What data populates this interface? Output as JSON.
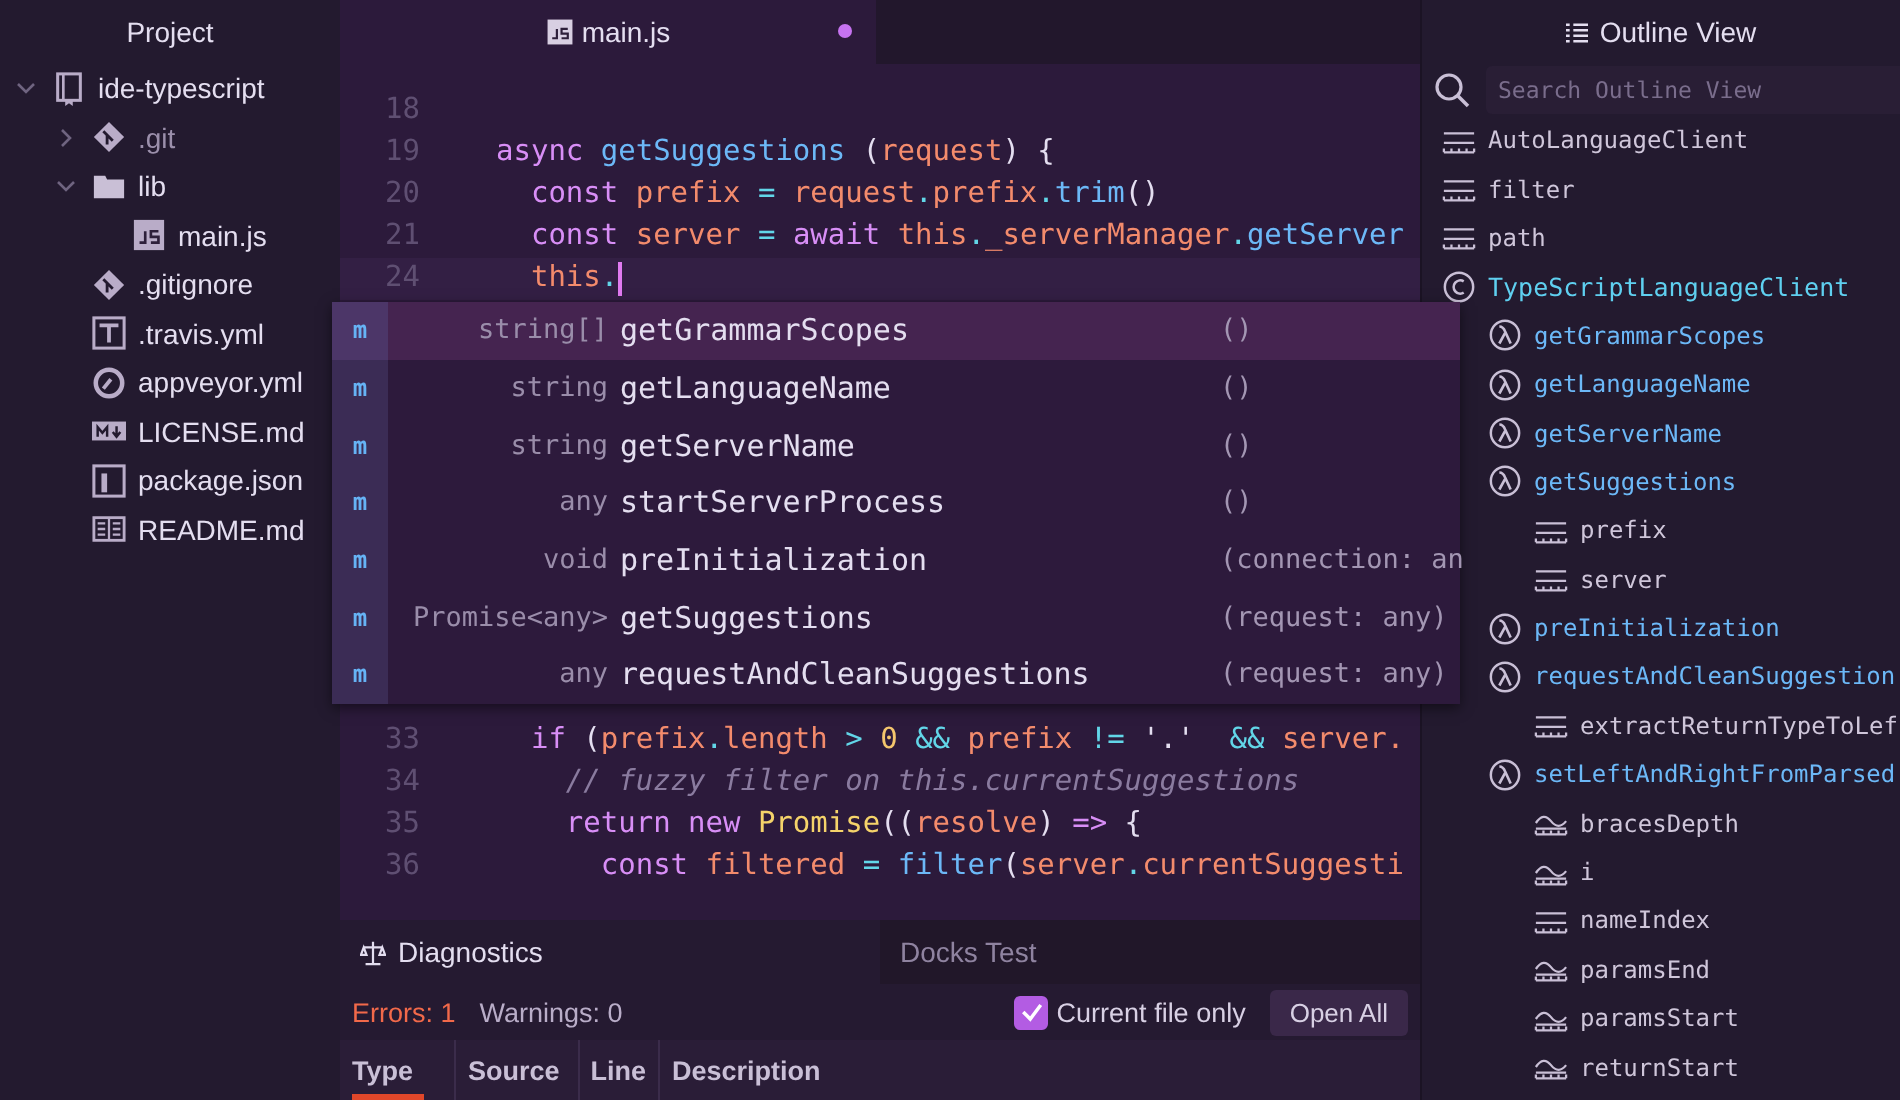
{
  "project": {
    "title": "Project",
    "tree": [
      {
        "name": "ide-typescript",
        "kind": "repo",
        "expanded": true,
        "children": [
          {
            "name": ".git",
            "kind": "git",
            "expanded": false
          },
          {
            "name": "lib",
            "kind": "folder",
            "expanded": true,
            "children": [
              {
                "name": "main.js",
                "kind": "js"
              }
            ]
          },
          {
            "name": ".gitignore",
            "kind": "git"
          },
          {
            "name": ".travis.yml",
            "kind": "travis"
          },
          {
            "name": "appveyor.yml",
            "kind": "appveyor"
          },
          {
            "name": "LICENSE.md",
            "kind": "markdown"
          },
          {
            "name": "package.json",
            "kind": "package"
          },
          {
            "name": "README.md",
            "kind": "readme"
          }
        ]
      }
    ]
  },
  "editor": {
    "tabs": [
      {
        "label": "main.js",
        "modified": true,
        "selected": true
      }
    ],
    "code_top": [
      {
        "number": "18"
      },
      {
        "number": "19",
        "tokens": [
          {
            "kind": "keyword",
            "text": "async "
          },
          {
            "kind": "function",
            "text": "getSuggestions"
          },
          {
            "kind": "plain",
            "text": " ("
          },
          {
            "kind": "variable",
            "text": "request"
          },
          {
            "kind": "plain",
            "text": ") {"
          }
        ]
      },
      {
        "number": "20",
        "tokens": [
          {
            "kind": "keyword",
            "text": "  const "
          },
          {
            "kind": "variable",
            "text": "prefix"
          },
          {
            "kind": "operator",
            "text": " = "
          },
          {
            "kind": "variable",
            "text": "request"
          },
          {
            "kind": "operator",
            "text": "."
          },
          {
            "kind": "variable",
            "text": "prefix"
          },
          {
            "kind": "operator",
            "text": "."
          },
          {
            "kind": "function",
            "text": "trim"
          },
          {
            "kind": "plain",
            "text": "()"
          }
        ]
      },
      {
        "number": "21",
        "tokens": [
          {
            "kind": "keyword",
            "text": "  const "
          },
          {
            "kind": "variable",
            "text": "server"
          },
          {
            "kind": "operator",
            "text": " = "
          },
          {
            "kind": "keyword",
            "text": "await "
          },
          {
            "kind": "variable",
            "text": "this"
          },
          {
            "kind": "operator",
            "text": "."
          },
          {
            "kind": "variable",
            "text": "_serverManager"
          },
          {
            "kind": "operator",
            "text": "."
          },
          {
            "kind": "function",
            "text": "getServer"
          }
        ]
      },
      {
        "number": "24",
        "cursor": true,
        "tokens": [
          {
            "kind": "variable",
            "text": "  this"
          },
          {
            "kind": "operator",
            "text": "."
          }
        ]
      }
    ],
    "code_bottom": [
      {
        "number": "33",
        "tokens": [
          {
            "kind": "keyword",
            "text": "  if "
          },
          {
            "kind": "plain",
            "text": "("
          },
          {
            "kind": "variable",
            "text": "prefix"
          },
          {
            "kind": "operator",
            "text": "."
          },
          {
            "kind": "variable",
            "text": "length"
          },
          {
            "kind": "operator",
            "text": " > "
          },
          {
            "kind": "number",
            "text": "0"
          },
          {
            "kind": "operator",
            "text": " && "
          },
          {
            "kind": "variable",
            "text": "prefix"
          },
          {
            "kind": "operator",
            "text": " != "
          },
          {
            "kind": "plain",
            "text": "'.'"
          },
          {
            "kind": "operator",
            "text": "  && "
          },
          {
            "kind": "variable",
            "text": "server."
          }
        ]
      },
      {
        "number": "34",
        "tokens": [
          {
            "kind": "comment",
            "text": "    // fuzzy filter on this.currentSuggestions"
          }
        ]
      },
      {
        "number": "35",
        "tokens": [
          {
            "kind": "keyword",
            "text": "    return new "
          },
          {
            "kind": "class",
            "text": "Promise"
          },
          {
            "kind": "plain",
            "text": "(("
          },
          {
            "kind": "variable",
            "text": "resolve"
          },
          {
            "kind": "plain",
            "text": ") "
          },
          {
            "kind": "keyword",
            "text": "=>"
          },
          {
            "kind": "plain",
            "text": " {"
          }
        ]
      },
      {
        "number": "36",
        "tokens": [
          {
            "kind": "keyword",
            "text": "      const "
          },
          {
            "kind": "variable",
            "text": "filtered"
          },
          {
            "kind": "operator",
            "text": " = "
          },
          {
            "kind": "function",
            "text": "filter"
          },
          {
            "kind": "plain",
            "text": "("
          },
          {
            "kind": "variable",
            "text": "server"
          },
          {
            "kind": "operator",
            "text": "."
          },
          {
            "kind": "variable",
            "text": "currentSuggesti"
          }
        ]
      }
    ]
  },
  "autocomplete": [
    {
      "badge": "m",
      "type": "string[]",
      "name": "getGrammarScopes",
      "params": "()",
      "selected": true
    },
    {
      "badge": "m",
      "type": "string",
      "name": "getLanguageName",
      "params": "()",
      "selected": false
    },
    {
      "badge": "m",
      "type": "string",
      "name": "getServerName",
      "params": "()",
      "selected": false
    },
    {
      "badge": "m",
      "type": "any",
      "name": "startServerProcess",
      "params": "()",
      "selected": false
    },
    {
      "badge": "m",
      "type": "void",
      "name": "preInitialization",
      "params": "(connection: an",
      "selected": false
    },
    {
      "badge": "m",
      "type": "Promise<any>",
      "name": "getSuggestions",
      "params": "(request: any)",
      "selected": false
    },
    {
      "badge": "m",
      "type": "any",
      "name": "requestAndCleanSuggestions",
      "params": "(request: any)",
      "selected": false
    }
  ],
  "dock": {
    "tabs": [
      {
        "label": "Diagnostics",
        "selected": true
      },
      {
        "label": "Docks Test",
        "selected": false
      }
    ],
    "errors": "Errors: 1",
    "warnings": "Warnings: 0",
    "current_file_only": {
      "label": "Current file only",
      "checked": true
    },
    "open_all": "Open All",
    "columns": [
      "Type",
      "Source",
      "Line",
      "Description"
    ]
  },
  "outline": {
    "title": "Outline View",
    "search": {
      "placeholder": "Search Outline View"
    },
    "items": [
      {
        "name": "AutoLanguageClient",
        "kind": "field"
      },
      {
        "name": "filter",
        "kind": "field"
      },
      {
        "name": "path",
        "kind": "field"
      },
      {
        "name": "TypeScriptLanguageClient",
        "kind": "class",
        "children": [
          {
            "name": "getGrammarScopes",
            "kind": "method"
          },
          {
            "name": "getLanguageName",
            "kind": "method"
          },
          {
            "name": "getServerName",
            "kind": "method"
          },
          {
            "name": "getSuggestions",
            "kind": "method",
            "children": [
              {
                "name": "prefix",
                "kind": "field"
              },
              {
                "name": "server",
                "kind": "field"
              }
            ]
          },
          {
            "name": "preInitialization",
            "kind": "method"
          },
          {
            "name": "requestAndCleanSuggestion",
            "kind": "method",
            "children": [
              {
                "name": "extractReturnTypeToLef",
                "kind": "field"
              }
            ]
          },
          {
            "name": "setLeftAndRightFromParsed",
            "kind": "method",
            "children": [
              {
                "name": "bracesDepth",
                "kind": "variable"
              },
              {
                "name": "i",
                "kind": "variable"
              },
              {
                "name": "nameIndex",
                "kind": "field"
              },
              {
                "name": "paramsEnd",
                "kind": "variable"
              },
              {
                "name": "paramsStart",
                "kind": "variable"
              },
              {
                "name": "returnStart",
                "kind": "variable"
              }
            ]
          }
        ]
      }
    ]
  }
}
